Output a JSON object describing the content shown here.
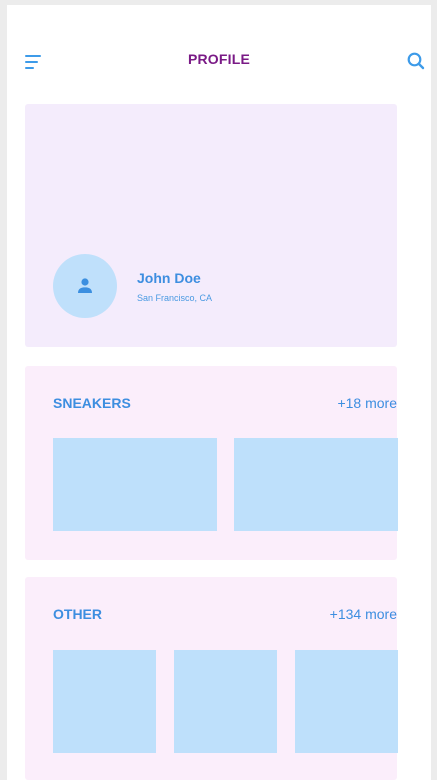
{
  "header": {
    "title": "PROFILE",
    "menu_icon": "menu-icon",
    "search_icon": "search-icon"
  },
  "profile": {
    "name": "John Doe",
    "location": "San Francisco, CA",
    "avatar_icon": "person-icon"
  },
  "sections": [
    {
      "title": "SNEAKERS",
      "more": "+18 more"
    },
    {
      "title": "OTHER",
      "more": "+134 more"
    }
  ],
  "colors": {
    "accent_blue": "#3d8ee0",
    "title_purple": "#7a1a86",
    "profile_card_bg": "#f4ecfc",
    "section_card_bg": "#fbeefb",
    "thumbnail_bg": "#bee0fb"
  }
}
